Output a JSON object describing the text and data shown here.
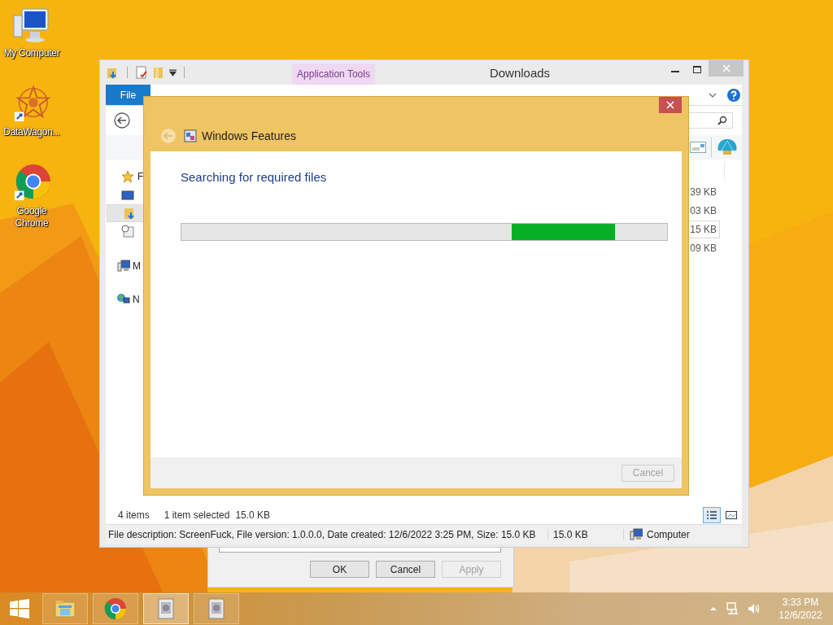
{
  "desktop_icons": [
    {
      "label": "My Computer",
      "kind": "computer"
    },
    {
      "label": "DataWagon...",
      "kind": "app"
    },
    {
      "label": "Google Chrome",
      "kind": "chrome"
    }
  ],
  "explorer": {
    "title": "Downloads",
    "context_tab": "Application Tools",
    "file_tab": "File",
    "nav_items": [
      {
        "kind": "favorites",
        "label": "F",
        "selected": false
      },
      {
        "kind": "desktop",
        "selected": false
      },
      {
        "kind": "downloads",
        "selected": true
      },
      {
        "kind": "recent",
        "selected": false
      },
      {
        "kind": "computer",
        "label": "M",
        "selected": false
      },
      {
        "kind": "network",
        "label": "N",
        "selected": false
      }
    ],
    "file_sizes": [
      {
        "size": "39 KB",
        "selected": false
      },
      {
        "size": "03 KB",
        "selected": false
      },
      {
        "size": "15 KB",
        "selected": true
      },
      {
        "size": "09 KB",
        "selected": false
      }
    ],
    "status": {
      "item_count": "4 items",
      "selection": "1 item selected",
      "selection_size": "15.0 KB"
    },
    "view_buttons": [
      {
        "kind": "details",
        "selected": true
      },
      {
        "kind": "large",
        "selected": false
      }
    ],
    "details_bar": {
      "description": "File description: ScreenFuck, File version: 1.0.0.0, Date created: 12/6/2022 3:25 PM, Size: 15.0 KB",
      "size": "15.0 KB",
      "zone": "Computer"
    }
  },
  "properties_dialog": {
    "buttons": [
      {
        "label": "OK",
        "disabled": false
      },
      {
        "label": "Cancel",
        "disabled": false
      },
      {
        "label": "Apply",
        "disabled": true
      }
    ]
  },
  "features_dialog": {
    "title": "Windows Features",
    "heading": "Searching for required files",
    "progress": {
      "kind": "marquee"
    },
    "cancel": {
      "label": "Cancel",
      "disabled": true
    }
  },
  "taskbar": {
    "buttons": [
      {
        "kind": "explorer",
        "selected": false
      },
      {
        "kind": "chrome",
        "selected": false
      },
      {
        "kind": "app",
        "selected": true
      },
      {
        "kind": "app",
        "selected": false
      }
    ],
    "time": "3:33 PM",
    "date": "12/6/2022"
  }
}
